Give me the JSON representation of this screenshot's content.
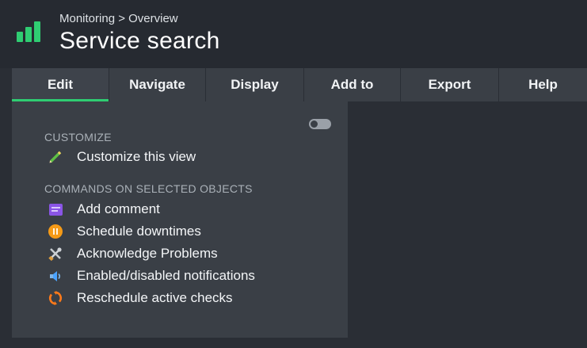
{
  "header": {
    "breadcrumb": "Monitoring > Overview",
    "title": "Service search"
  },
  "menu": {
    "tabs": [
      {
        "label": "Edit",
        "active": true
      },
      {
        "label": "Navigate",
        "active": false
      },
      {
        "label": "Display",
        "active": false
      },
      {
        "label": "Add to",
        "active": false
      },
      {
        "label": "Export",
        "active": false
      },
      {
        "label": "Help",
        "active": false
      }
    ]
  },
  "dropdown": {
    "toggle_state": "off",
    "customize": {
      "heading": "CUSTOMIZE",
      "items": [
        {
          "label": "Customize this view",
          "icon": "pencil-icon"
        }
      ]
    },
    "commands": {
      "heading": "COMMANDS ON SELECTED OBJECTS",
      "items": [
        {
          "label": "Add comment",
          "icon": "comment-icon"
        },
        {
          "label": "Schedule downtimes",
          "icon": "pause-icon"
        },
        {
          "label": "Acknowledge Problems",
          "icon": "tools-icon"
        },
        {
          "label": "Enabled/disabled notifications",
          "icon": "speaker-icon"
        },
        {
          "label": "Reschedule active checks",
          "icon": "refresh-icon"
        }
      ]
    }
  },
  "colors": {
    "accent": "#2fcd72",
    "background": "#2a2e35",
    "panel": "#3a3f46",
    "comment_icon": "#8a55e6",
    "pause_icon": "#f59a17",
    "refresh_icon": "#ff7a1a",
    "speaker_icon": "#4aa3ff"
  }
}
